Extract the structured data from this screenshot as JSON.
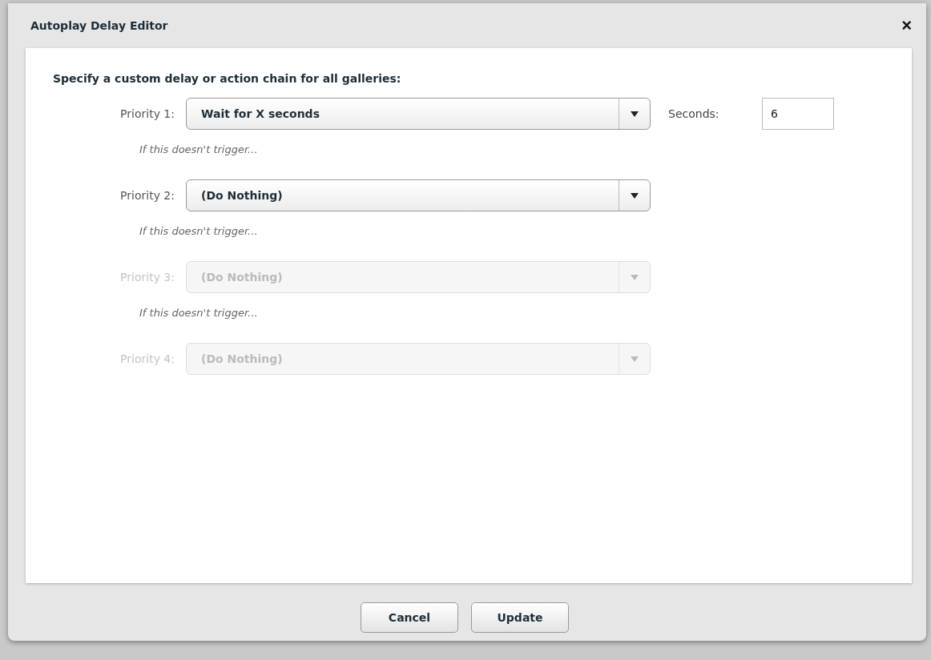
{
  "dialog": {
    "title": "Autoplay Delay Editor",
    "close": "×"
  },
  "heading": "Specify a custom delay or action chain for all galleries:",
  "priorities": [
    {
      "label": "Priority 1:",
      "value": "Wait for X seconds",
      "disabled": false,
      "hint": "If this doesn't trigger...",
      "seconds": {
        "label": "Seconds:",
        "value": "6"
      }
    },
    {
      "label": "Priority 2:",
      "value": "(Do Nothing)",
      "disabled": false,
      "hint": "If this doesn't trigger..."
    },
    {
      "label": "Priority 3:",
      "value": "(Do Nothing)",
      "disabled": true,
      "hint": "If this doesn't trigger..."
    },
    {
      "label": "Priority 4:",
      "value": "(Do Nothing)",
      "disabled": true
    }
  ],
  "buttons": [
    "Cancel",
    "Update"
  ]
}
